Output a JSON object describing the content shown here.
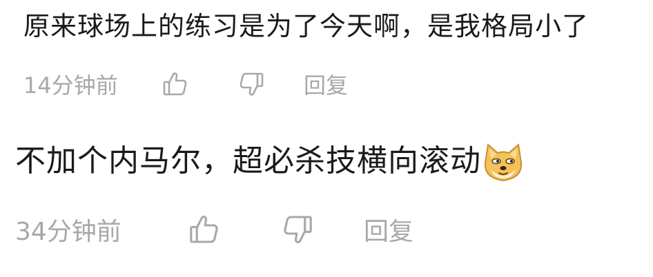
{
  "comments": [
    {
      "text": "原来球场上的练习是为了今天啊，是我格局小了",
      "time": "14分钟前",
      "reply_label": "回复"
    },
    {
      "text": "不加个内马尔，超必杀技横向滚动",
      "emoji": "doge-emoji",
      "time": "34分钟前",
      "reply_label": "回复"
    }
  ],
  "colors": {
    "text": "#1a1a1a",
    "meta": "#a8a8a8",
    "emoji_face": "#f3c35a"
  }
}
